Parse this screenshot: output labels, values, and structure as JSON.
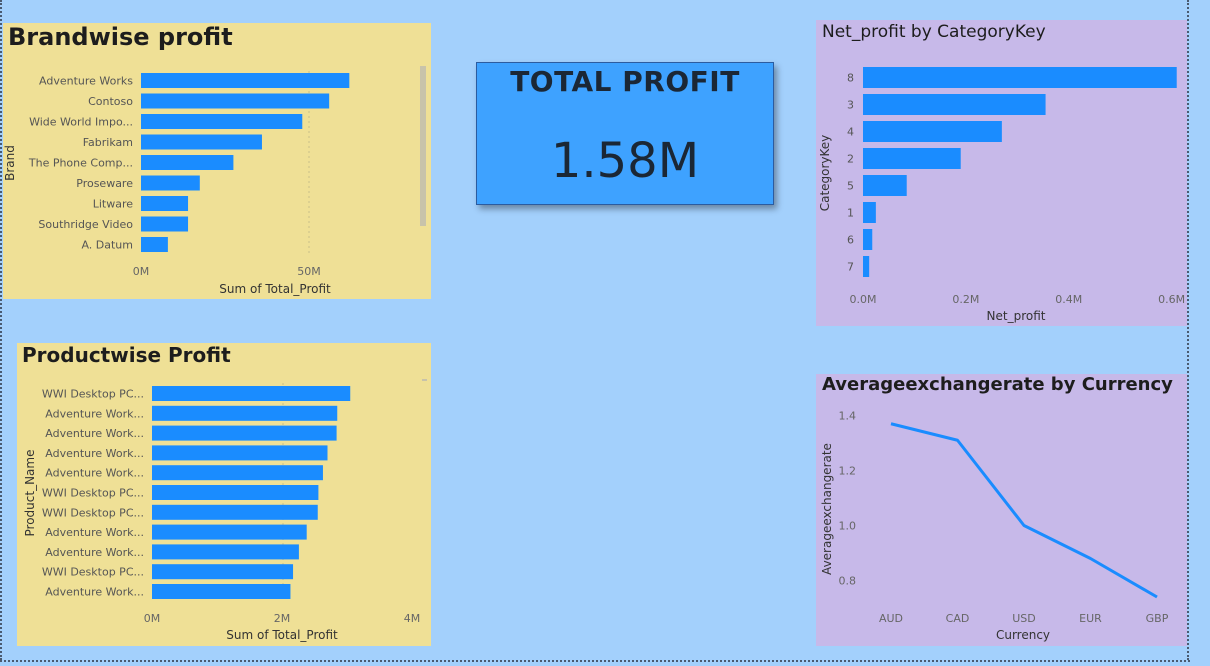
{
  "kpi": {
    "title": "TOTAL PROFIT",
    "value": "1.58M"
  },
  "colors": {
    "bar": "#1a8cff",
    "line": "#1a8cff",
    "card_yellow": "#efe096",
    "card_purple": "#c7b9e9",
    "background": "#a3d0fc"
  },
  "chart_data": [
    {
      "id": "brandwise",
      "type": "bar",
      "orientation": "horizontal",
      "title": "Brandwise profit",
      "xlabel": "Sum of Total_Profit",
      "ylabel": "Brand",
      "categories": [
        "Adventure Works",
        "Contoso",
        "Wide World Impo...",
        "Fabrikam",
        "The Phone Comp...",
        "Proseware",
        "Litware",
        "Southridge Video",
        "A. Datum"
      ],
      "values": [
        62,
        56,
        48,
        36,
        27.5,
        17.5,
        14,
        14,
        8
      ],
      "xticks": [
        "0M",
        "50M"
      ],
      "xtick_values": [
        0,
        50
      ],
      "xlim": [
        0,
        100
      ]
    },
    {
      "id": "productwise",
      "type": "bar",
      "orientation": "horizontal",
      "title": "Productwise Profit",
      "xlabel": "Sum of Total_Profit",
      "ylabel": "Product_Name",
      "categories": [
        "WWI Desktop PC...",
        "Adventure Work...",
        "Adventure Work...",
        "Adventure Work...",
        "Adventure Work...",
        "WWI Desktop PC...",
        "WWI Desktop PC...",
        "Adventure Work...",
        "Adventure Work...",
        "WWI Desktop PC...",
        "Adventure Work..."
      ],
      "values": [
        3.05,
        2.85,
        2.84,
        2.7,
        2.63,
        2.56,
        2.55,
        2.38,
        2.26,
        2.17,
        2.13
      ],
      "xticks": [
        "0M",
        "2M",
        "4M"
      ],
      "xtick_values": [
        0,
        2,
        4
      ],
      "xlim": [
        0,
        4
      ]
    },
    {
      "id": "category",
      "type": "bar",
      "orientation": "horizontal",
      "title": "Net_profit by CategoryKey",
      "xlabel": "Net_profit",
      "ylabel": "CategoryKey",
      "categories": [
        "8",
        "3",
        "4",
        "2",
        "5",
        "1",
        "6",
        "7"
      ],
      "values": [
        0.61,
        0.355,
        0.27,
        0.19,
        0.085,
        0.025,
        0.018,
        0.012
      ],
      "xticks": [
        "0.0M",
        "0.2M",
        "0.4M",
        "0.6M"
      ],
      "xtick_values": [
        0,
        0.2,
        0.4,
        0.6
      ],
      "xlim": [
        0,
        0.7
      ]
    },
    {
      "id": "currency",
      "type": "line",
      "title": "Averageexchangerate by Currency",
      "xlabel": "Currency",
      "ylabel": "Averageexchangerate",
      "categories": [
        "AUD",
        "CAD",
        "USD",
        "EUR",
        "GBP"
      ],
      "values": [
        1.37,
        1.31,
        1.0,
        0.88,
        0.74
      ],
      "yticks": [
        "0.8",
        "1.0",
        "1.2",
        "1.4"
      ],
      "ytick_values": [
        0.8,
        1.0,
        1.2,
        1.4
      ],
      "ylim": [
        0.7,
        1.42
      ]
    }
  ]
}
